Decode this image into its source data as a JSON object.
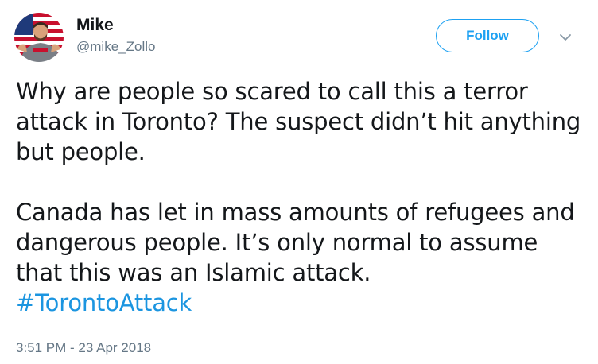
{
  "author": {
    "name": "Mike",
    "handle": "@mike_Zollo",
    "avatar_icon": "user-avatar-flag-photo"
  },
  "header": {
    "follow_label": "Follow",
    "more_icon": "chevron-down-icon"
  },
  "tweet": {
    "paragraph_1": "Why are people so scared to call this a terror attack in Toronto? The suspect didn’t hit anything but people.",
    "paragraph_2": "Canada has let in mass amounts of refugees and dangerous people. It’s only normal to assume that this was an Islamic attack.",
    "hashtag": "#TorontoAttack",
    "timestamp": "3:51 PM - 23 Apr 2018"
  },
  "colors": {
    "accent": "#1da1f2",
    "hashtag": "#1b95e0",
    "text": "#14171a",
    "muted": "#657786"
  }
}
